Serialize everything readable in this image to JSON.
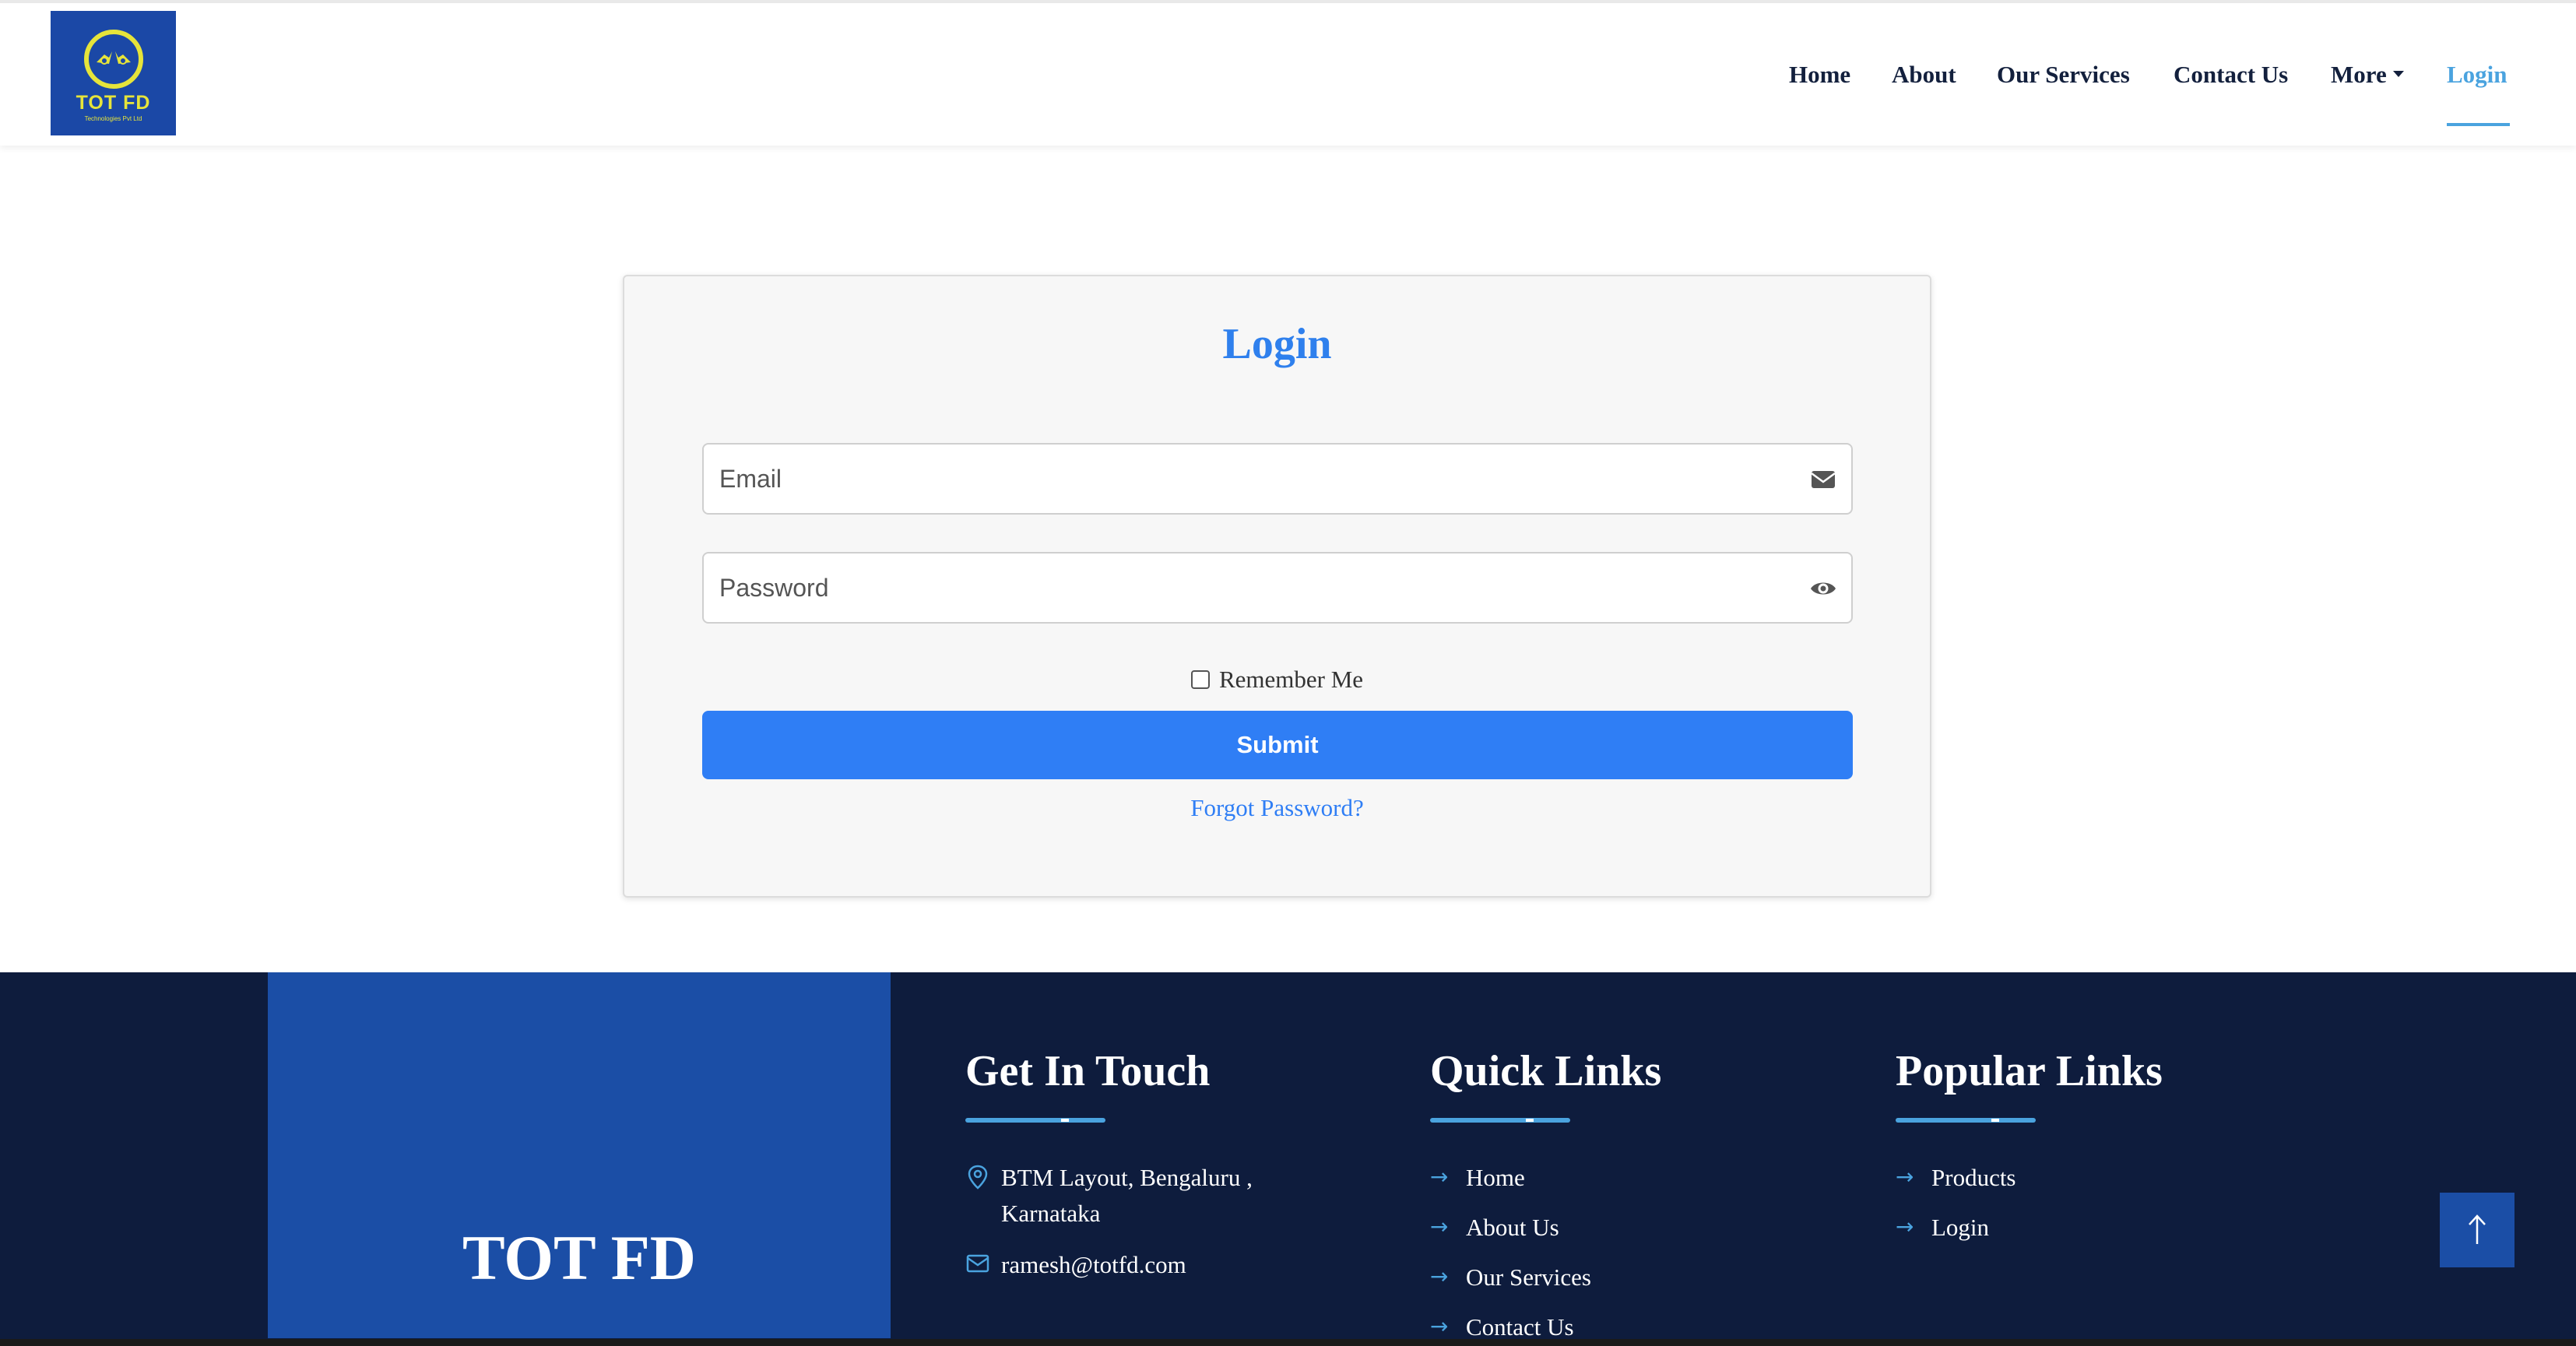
{
  "header": {
    "logo": {
      "name": "TOT FD",
      "subtitle": "Technologies Pvt Ltd"
    },
    "nav": [
      {
        "label": "Home"
      },
      {
        "label": "About"
      },
      {
        "label": "Our Services"
      },
      {
        "label": "Contact Us"
      },
      {
        "label": "More"
      },
      {
        "label": "Login",
        "active": true
      }
    ]
  },
  "login": {
    "title": "Login",
    "email_placeholder": "Email",
    "email_value": "",
    "password_placeholder": "Password",
    "password_value": "",
    "remember_label": "Remember Me",
    "remember_checked": false,
    "submit_label": "Submit",
    "forgot_label": "Forgot Password?"
  },
  "footer": {
    "brand": "TOT FD",
    "get_in_touch": {
      "title": "Get In Touch",
      "address_line1": "BTM Layout, Bengaluru ,",
      "address_line2": "Karnataka",
      "email": "ramesh@totfd.com"
    },
    "quick_links": {
      "title": "Quick Links",
      "items": [
        "Home",
        "About Us",
        "Our Services",
        "Contact Us"
      ]
    },
    "popular_links": {
      "title": "Popular Links",
      "items": [
        "Products",
        "Login"
      ]
    }
  },
  "icons": {
    "email": "envelope-icon",
    "password": "eye-icon",
    "address": "map-pin-icon",
    "mail": "mail-icon",
    "link_arrow": "arrow-right-icon",
    "back_to_top": "arrow-up-icon"
  },
  "colors": {
    "accent": "#2f7ef5",
    "nav_active": "#4aa3df",
    "footer_bg": "#0e1c3d",
    "brand_box": "#1b4ea6",
    "logo_bg": "#1b48a6",
    "logo_yellow": "#e6e43a"
  }
}
